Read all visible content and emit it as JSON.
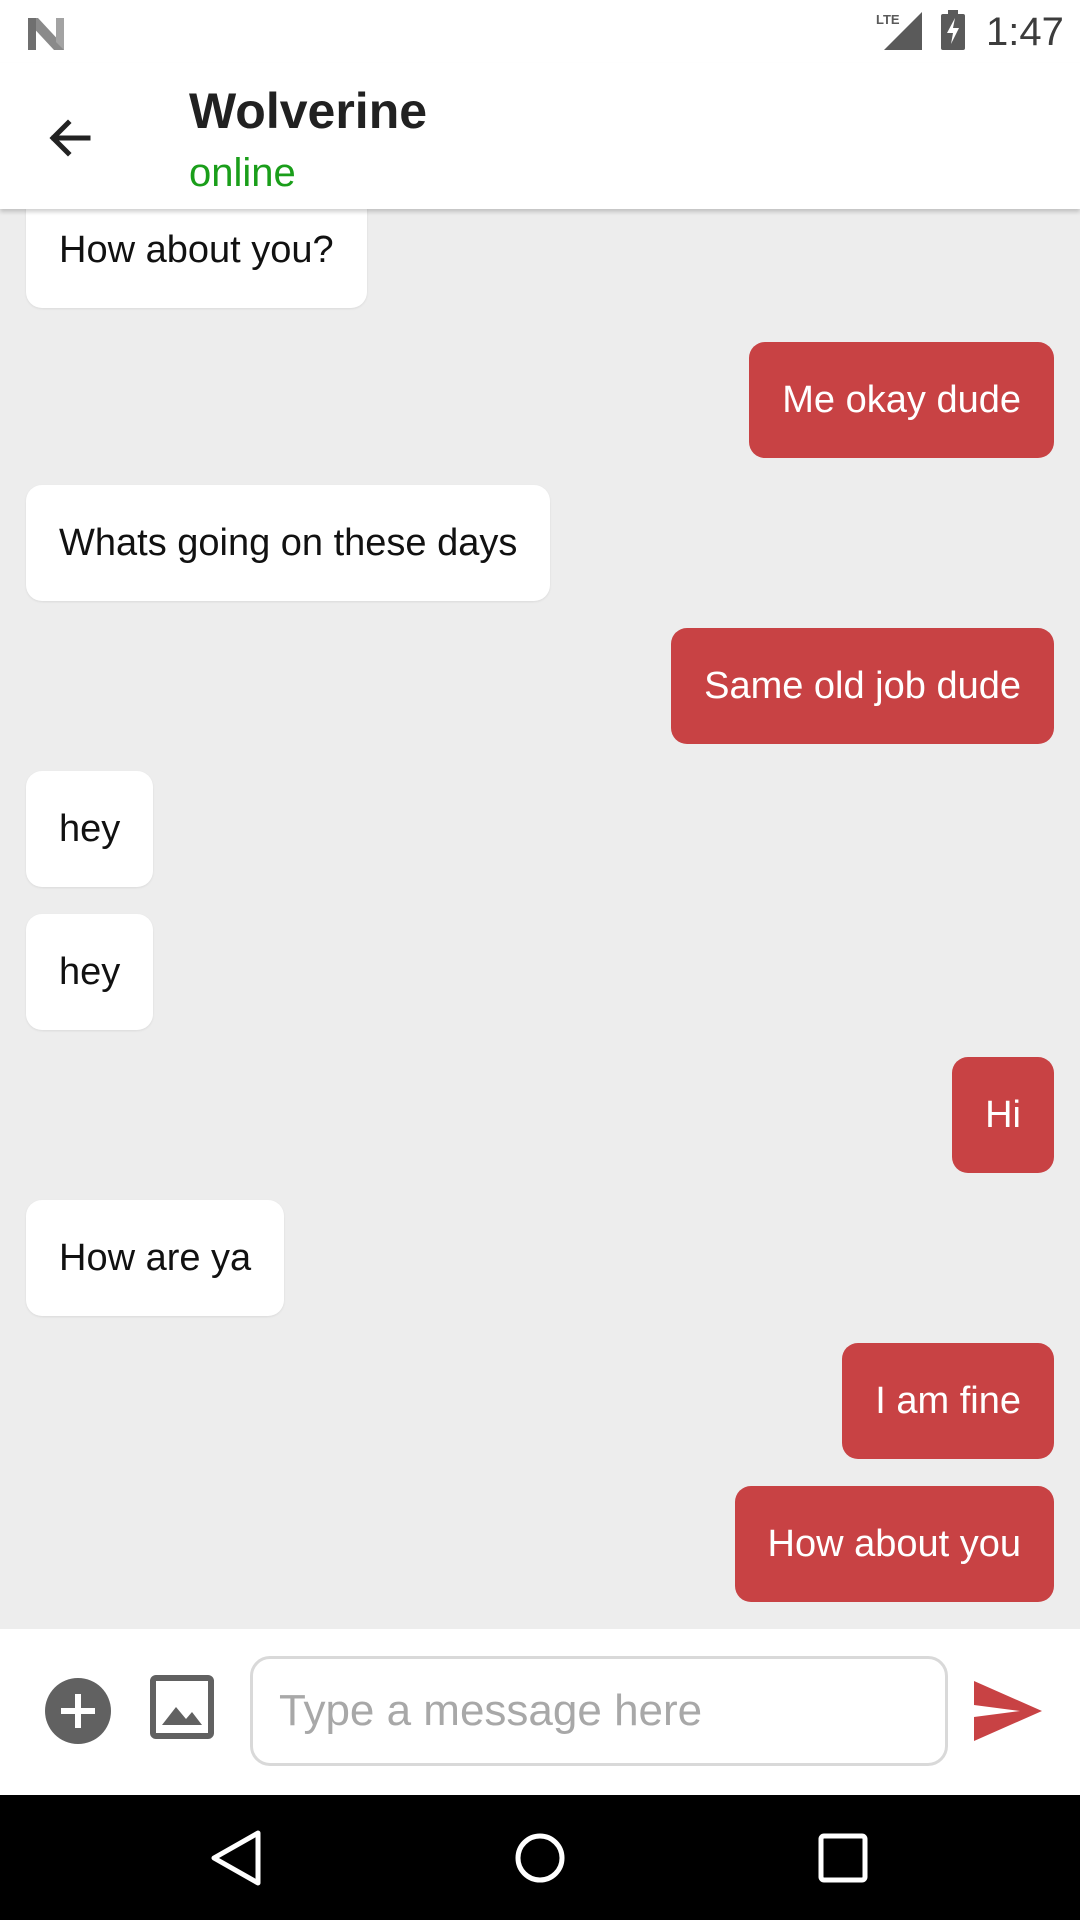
{
  "status_bar": {
    "time": "1:47",
    "network_label": "LTE",
    "icons": [
      "android-n-icon",
      "lte-signal-icon",
      "battery-charging-icon"
    ]
  },
  "toolbar": {
    "contact_name": "Wolverine",
    "status": "online",
    "back_icon": "arrow-back-icon"
  },
  "messages": [
    {
      "direction": "in",
      "text": "How about you?"
    },
    {
      "direction": "out",
      "text": "Me okay dude"
    },
    {
      "direction": "in",
      "text": "Whats going on these days"
    },
    {
      "direction": "out",
      "text": "Same old job dude"
    },
    {
      "direction": "in",
      "text": "hey"
    },
    {
      "direction": "in",
      "text": "hey"
    },
    {
      "direction": "out",
      "text": "Hi"
    },
    {
      "direction": "in",
      "text": "How are ya"
    },
    {
      "direction": "out",
      "text": "I am fine"
    },
    {
      "direction": "out",
      "text": "How about you"
    }
  ],
  "composer": {
    "placeholder": "Type a message here",
    "value": "",
    "add_icon": "add-circle-icon",
    "image_icon": "image-icon",
    "send_icon": "send-icon"
  },
  "nav_bar": {
    "icons": [
      "nav-back-icon",
      "nav-home-icon",
      "nav-recents-icon"
    ]
  },
  "colors": {
    "accent": "#c84244",
    "online": "#1a9e1a",
    "chat_background": "#ededed",
    "incoming_bubble": "#ffffff"
  }
}
